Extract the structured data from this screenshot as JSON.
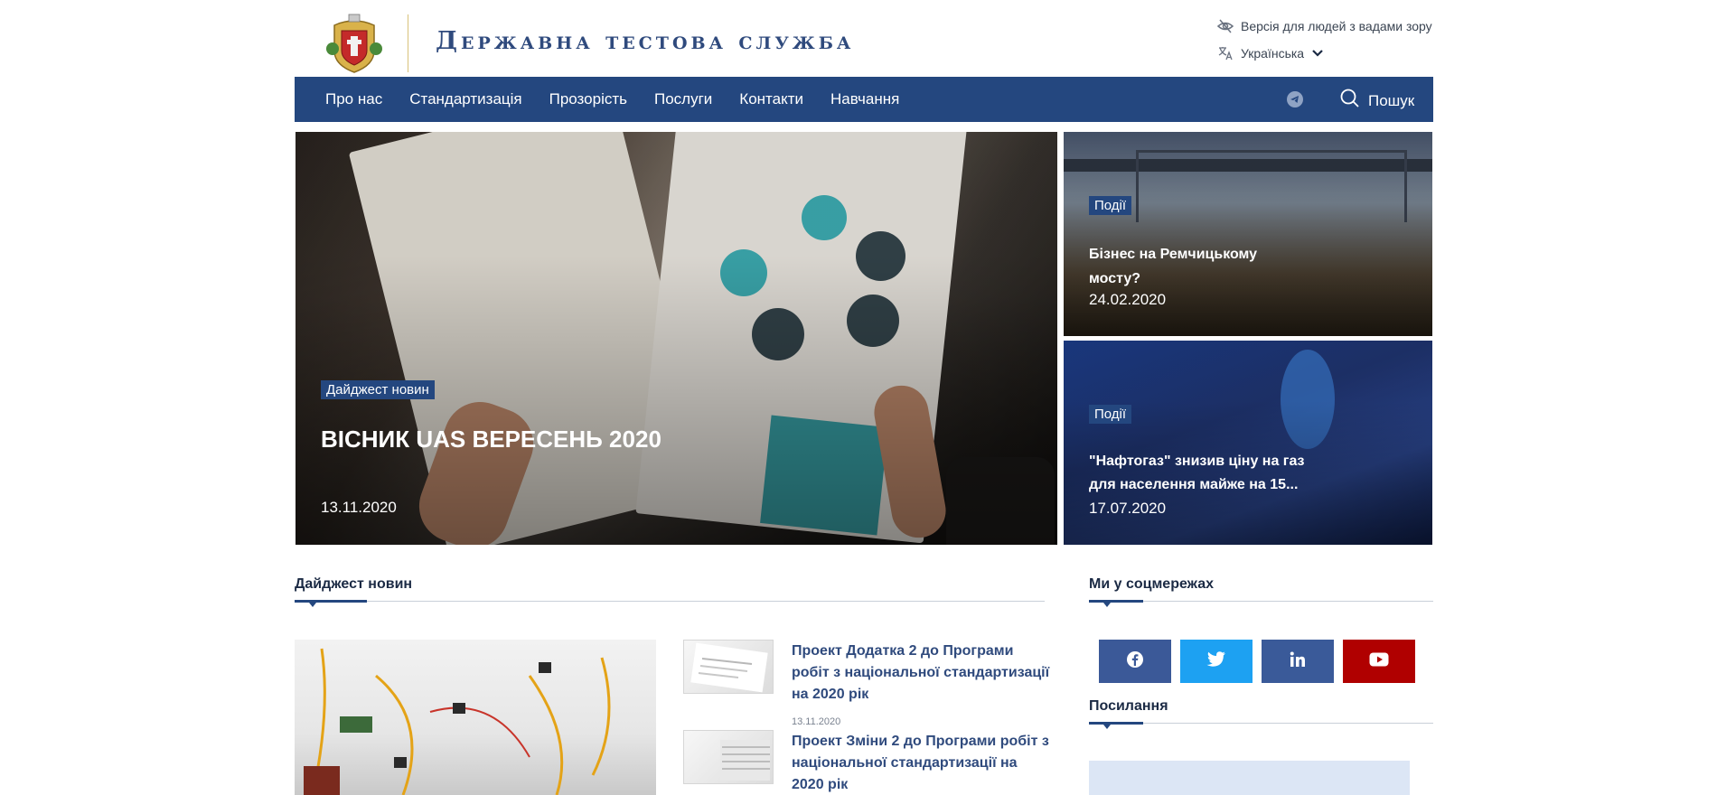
{
  "header": {
    "site_title": "Державна тестова служба",
    "a11y_label": "Версія для людей з вадами зору",
    "language": "Українська"
  },
  "nav": {
    "items": [
      {
        "label": "Про нас"
      },
      {
        "label": "Стандартизація"
      },
      {
        "label": "Прозорість"
      },
      {
        "label": "Послуги"
      },
      {
        "label": "Контакти"
      },
      {
        "label": "Навчання"
      }
    ],
    "search_label": "Пошук"
  },
  "hero": {
    "main": {
      "tag": "Дайджест новин",
      "title": "ВІСНИК UAS ВЕРЕСЕНЬ 2020",
      "date": "13.11.2020"
    },
    "side": [
      {
        "tag": "Події",
        "title_line1": "Бізнес на Ремчицькому",
        "title_line2": "мосту?",
        "date": "24.02.2020"
      },
      {
        "tag": "Події",
        "title_line1": "\"Нафтогаз\" знизив ціну на газ",
        "title_line2": "для населення майже на 15...",
        "date": "17.07.2020"
      }
    ]
  },
  "digest": {
    "section_title": "Дайджест новин",
    "items": [
      {
        "title_lines": [
          "Проект Додатка 2 до Програми",
          "робіт з національної стандартизації",
          "на 2020 рік"
        ],
        "date": "13.11.2020"
      },
      {
        "title_lines": [
          "Проект Зміни 2 до Програми робіт з",
          "національної стандартизації на",
          "2020 рік"
        ]
      }
    ]
  },
  "social": {
    "section_title": "Ми у соцмережах",
    "buttons": [
      {
        "icon": "facebook-icon",
        "color": "#3b5998"
      },
      {
        "icon": "twitter-icon",
        "color": "#1da1f2"
      },
      {
        "icon": "linkedin-icon",
        "color": "#3a5a99"
      },
      {
        "icon": "youtube-icon",
        "color": "#b00000"
      }
    ]
  },
  "links": {
    "section_title": "Посилання"
  },
  "colors": {
    "brand_blue": "#24477f",
    "title_blue": "#2f4a7d"
  }
}
